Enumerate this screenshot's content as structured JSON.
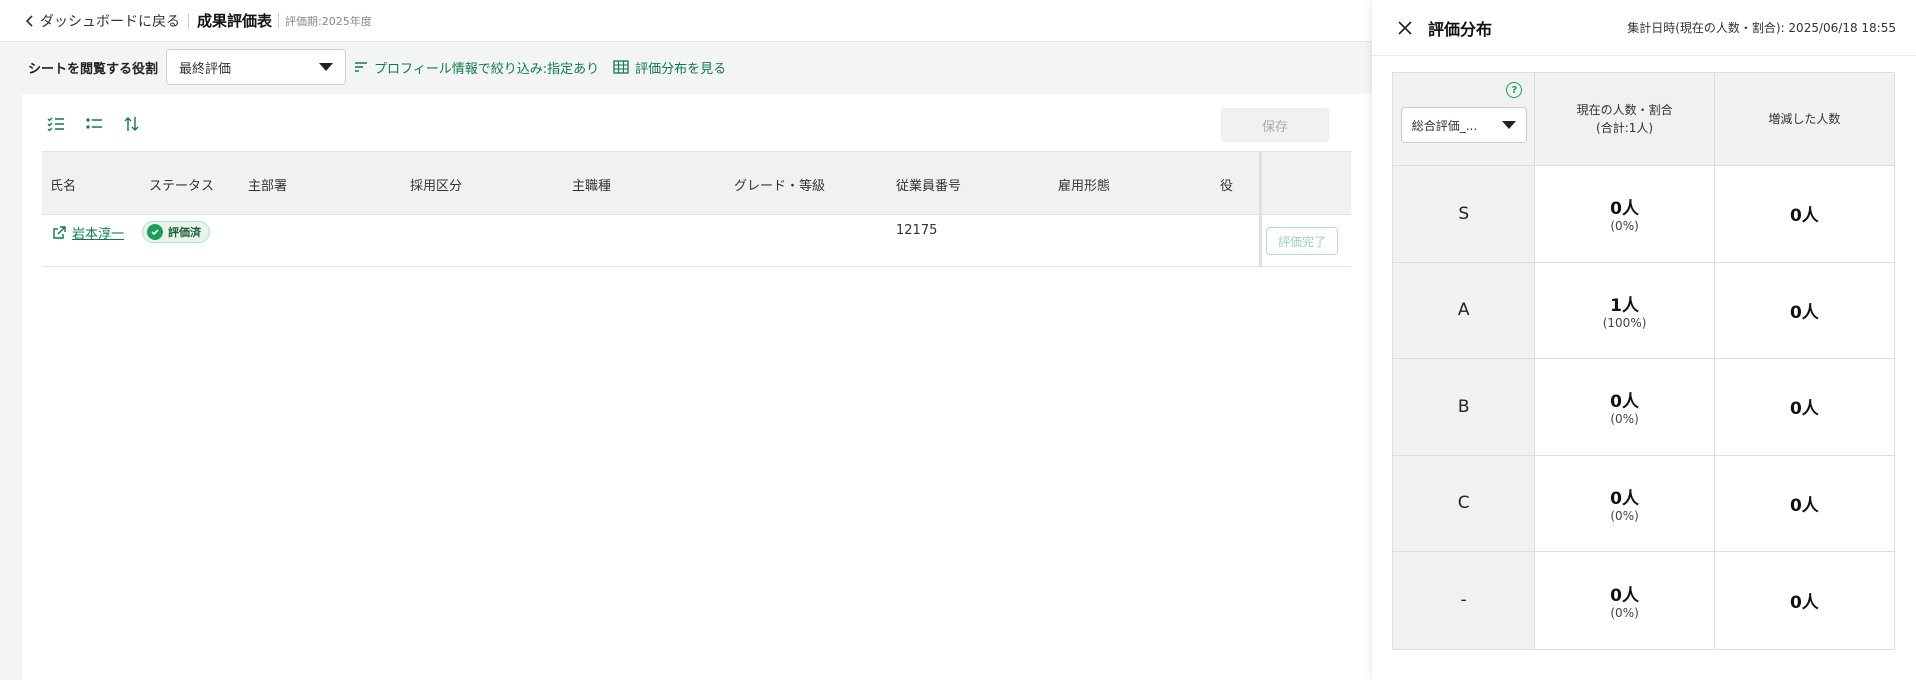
{
  "header": {
    "back_label": "ダッシュボードに戻る",
    "title": "成果評価表",
    "period": "評価期:2025年度"
  },
  "filters": {
    "role_label": "シートを閲覧する役割",
    "role_value": "最終評価",
    "profile_filter": "プロフィール情報で絞り込み:指定あり",
    "distribution_link": "評価分布を見る"
  },
  "toolbar": {
    "save_label": "保存"
  },
  "table": {
    "columns": [
      "氏名",
      "ステータス",
      "主部署",
      "採用区分",
      "主職種",
      "グレード・等級",
      "従業員番号",
      "雇用形態",
      "役"
    ],
    "rows": [
      {
        "name": "岩本淳一",
        "status": "評価済",
        "employee_no": "12175",
        "action": "評価完了"
      }
    ]
  },
  "panel": {
    "title": "評価分布",
    "date_label": "集計日時(現在の人数・割合):  2025/06/18 18:55",
    "select_value": "総合評価_...",
    "col_current": "現在の人数・割合",
    "col_current_total": "(合計:1人)",
    "col_change": "増減した人数",
    "rows": [
      {
        "grade": "S",
        "count": "0人",
        "pct": "(0%)",
        "change": "0人"
      },
      {
        "grade": "A",
        "count": "1人",
        "pct": "(100%)",
        "change": "0人"
      },
      {
        "grade": "B",
        "count": "0人",
        "pct": "(0%)",
        "change": "0人"
      },
      {
        "grade": "C",
        "count": "0人",
        "pct": "(0%)",
        "change": "0人"
      },
      {
        "grade": "-",
        "count": "0人",
        "pct": "(0%)",
        "change": "0人"
      }
    ]
  },
  "colors": {
    "accent_green": "#0f7b4a",
    "badge_green": "#1b9e5a"
  }
}
